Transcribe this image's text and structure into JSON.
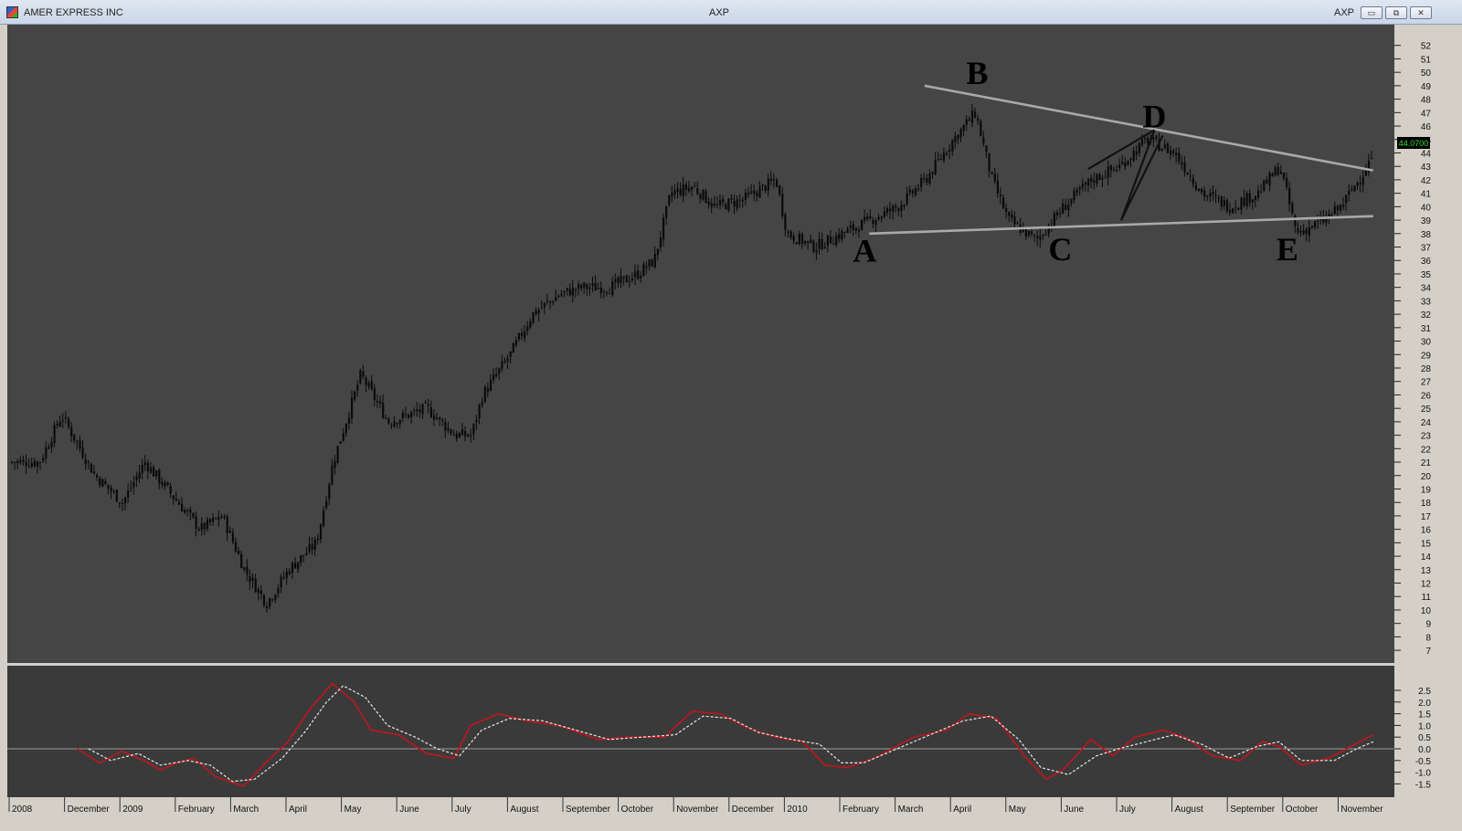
{
  "window": {
    "title_left": "AMER EXPRESS INC",
    "title_center": "AXP",
    "title_right": "AXP",
    "buttons": {
      "minimize": "▭",
      "restore": "⧉",
      "close": "✕"
    }
  },
  "colors": {
    "price_bg": "#454545",
    "ind_bg": "#3a3a3a",
    "candle": "#0a0a0a",
    "trendline": "#a9a9a9",
    "macd": "#c0161d",
    "signal": "#e8e8e8",
    "last_price_bg": "#000000",
    "last_price_fg": "#2fe02f"
  },
  "chart_data": [
    {
      "type": "candlestick",
      "symbol": "AXP",
      "ylim": [
        6,
        53
      ],
      "y_ticks": [
        7,
        8,
        9,
        10,
        11,
        12,
        13,
        14,
        15,
        16,
        17,
        18,
        19,
        20,
        21,
        22,
        23,
        24,
        25,
        26,
        27,
        28,
        29,
        30,
        31,
        32,
        33,
        34,
        35,
        36,
        37,
        38,
        39,
        40,
        41,
        42,
        43,
        44,
        45,
        46,
        47,
        48,
        49,
        50,
        51,
        52
      ],
      "last_price": "44.0700",
      "x_ticks": [
        "2008",
        "December",
        "2009",
        "February",
        "March",
        "April",
        "May",
        "June",
        "July",
        "August",
        "September",
        "October",
        "November",
        "December",
        "2010",
        "February",
        "March",
        "April",
        "May",
        "June",
        "July",
        "August",
        "September",
        "October",
        "November"
      ],
      "close_path": [
        [
          0,
          21
        ],
        [
          0.5,
          21
        ],
        [
          0.9,
          24.5
        ],
        [
          1.5,
          20
        ],
        [
          2,
          18
        ],
        [
          2.4,
          21
        ],
        [
          3,
          18
        ],
        [
          3.4,
          16
        ],
        [
          3.8,
          17
        ],
        [
          4.2,
          13
        ],
        [
          4.6,
          10.5
        ],
        [
          5,
          13
        ],
        [
          5.5,
          15
        ],
        [
          5.8,
          21
        ],
        [
          6.3,
          27.5
        ],
        [
          6.8,
          24
        ],
        [
          7.5,
          25
        ],
        [
          8,
          23
        ],
        [
          8.3,
          23
        ],
        [
          8.5,
          26
        ],
        [
          9,
          29
        ],
        [
          9.4,
          32
        ],
        [
          9.9,
          33.5
        ],
        [
          10.3,
          34
        ],
        [
          10.8,
          34
        ],
        [
          11.3,
          35
        ],
        [
          11.6,
          36
        ],
        [
          11.9,
          41
        ],
        [
          12.3,
          41.5
        ],
        [
          12.7,
          40
        ],
        [
          13.2,
          40.5
        ],
        [
          13.6,
          41.5
        ],
        [
          13.8,
          42
        ],
        [
          14,
          38
        ],
        [
          14.5,
          37
        ],
        [
          15,
          38
        ],
        [
          15.5,
          39
        ],
        [
          16,
          40
        ],
        [
          16.5,
          42
        ],
        [
          17,
          45
        ],
        [
          17.4,
          47
        ],
        [
          17.7,
          42
        ],
        [
          18,
          39
        ],
        [
          18.5,
          37.5
        ],
        [
          19,
          40
        ],
        [
          19.5,
          42
        ],
        [
          20,
          43
        ],
        [
          20.5,
          45
        ],
        [
          21,
          44
        ],
        [
          21.5,
          41
        ],
        [
          22,
          40
        ],
        [
          22.5,
          41
        ],
        [
          22.9,
          43
        ],
        [
          23.2,
          38
        ],
        [
          23.7,
          39
        ],
        [
          24,
          40
        ],
        [
          24.4,
          42.5
        ],
        [
          24.6,
          44
        ]
      ],
      "annotations": [
        {
          "label": "A",
          "x": 15.42,
          "price": 36.8
        },
        {
          "label": "B",
          "x": 17.45,
          "price": 50.0
        },
        {
          "label": "C",
          "x": 18.95,
          "price": 36.9
        },
        {
          "label": "D",
          "x": 20.65,
          "price": 46.8
        },
        {
          "label": "E",
          "x": 23.05,
          "price": 36.9
        }
      ],
      "trendlines": [
        {
          "name": "upper",
          "from": [
            16.5,
            49.0
          ],
          "to": [
            24.6,
            42.7
          ]
        },
        {
          "name": "lower",
          "from": [
            15.5,
            38.0
          ],
          "to": [
            24.6,
            39.3
          ]
        },
        {
          "name": "inner-1",
          "from": [
            19.45,
            42.8
          ],
          "to": [
            20.65,
            45.7
          ]
        },
        {
          "name": "inner-2",
          "from": [
            20.65,
            45.7
          ],
          "to": [
            20.05,
            39.0
          ]
        },
        {
          "name": "inner-3",
          "from": [
            20.05,
            39.0
          ],
          "to": [
            20.8,
            45.3
          ]
        }
      ]
    },
    {
      "type": "line",
      "name": "oscillator",
      "ylim": [
        -1.9,
        3.0
      ],
      "y_ticks": [
        "2.5",
        "2.0",
        "1.5",
        "1.0",
        "0.5",
        "0.0",
        "-0.5",
        "-1.0",
        "-1.5"
      ],
      "zero_line": 0,
      "series": [
        {
          "style": "solid",
          "points": [
            [
              1.2,
              0.0
            ],
            [
              1.6,
              -0.6
            ],
            [
              2.0,
              -0.1
            ],
            [
              2.4,
              -0.5
            ],
            [
              2.7,
              -0.9
            ],
            [
              3.0,
              -0.6
            ],
            [
              3.3,
              -0.4
            ],
            [
              3.7,
              -1.2
            ],
            [
              4.2,
              -1.6
            ],
            [
              4.6,
              -0.6
            ],
            [
              5.0,
              0.3
            ],
            [
              5.4,
              1.7
            ],
            [
              5.8,
              2.8
            ],
            [
              6.2,
              2.0
            ],
            [
              6.5,
              0.8
            ],
            [
              7.0,
              0.6
            ],
            [
              7.5,
              -0.2
            ],
            [
              8.0,
              -0.4
            ],
            [
              8.3,
              1.0
            ],
            [
              8.8,
              1.5
            ],
            [
              9.3,
              1.2
            ],
            [
              9.9,
              1.0
            ],
            [
              10.6,
              0.4
            ],
            [
              11.2,
              0.5
            ],
            [
              11.8,
              0.5
            ],
            [
              12.3,
              1.6
            ],
            [
              12.8,
              1.5
            ],
            [
              13.3,
              0.9
            ],
            [
              13.8,
              0.5
            ],
            [
              14.3,
              0.3
            ],
            [
              14.7,
              -0.7
            ],
            [
              15.1,
              -0.8
            ],
            [
              15.6,
              -0.4
            ],
            [
              16.3,
              0.5
            ],
            [
              16.9,
              0.8
            ],
            [
              17.3,
              1.5
            ],
            [
              17.8,
              1.3
            ],
            [
              18.3,
              -0.3
            ],
            [
              18.7,
              -1.3
            ],
            [
              19.0,
              -0.9
            ],
            [
              19.5,
              0.4
            ],
            [
              19.9,
              -0.3
            ],
            [
              20.3,
              0.5
            ],
            [
              20.8,
              0.8
            ],
            [
              21.2,
              0.5
            ],
            [
              21.7,
              -0.3
            ],
            [
              22.2,
              -0.5
            ],
            [
              22.6,
              0.3
            ],
            [
              22.9,
              0.1
            ],
            [
              23.3,
              -0.7
            ],
            [
              23.8,
              -0.4
            ],
            [
              24.2,
              0.1
            ],
            [
              24.6,
              0.6
            ]
          ]
        },
        {
          "style": "dashed",
          "points": [
            [
              1.4,
              0.0
            ],
            [
              1.8,
              -0.5
            ],
            [
              2.3,
              -0.2
            ],
            [
              2.7,
              -0.7
            ],
            [
              3.2,
              -0.5
            ],
            [
              3.6,
              -0.7
            ],
            [
              4.0,
              -1.4
            ],
            [
              4.4,
              -1.3
            ],
            [
              4.9,
              -0.4
            ],
            [
              5.3,
              0.7
            ],
            [
              5.7,
              2.0
            ],
            [
              6.0,
              2.7
            ],
            [
              6.4,
              2.2
            ],
            [
              6.8,
              1.0
            ],
            [
              7.3,
              0.5
            ],
            [
              7.7,
              0.0
            ],
            [
              8.1,
              -0.3
            ],
            [
              8.5,
              0.8
            ],
            [
              9.0,
              1.3
            ],
            [
              9.6,
              1.2
            ],
            [
              10.2,
              0.8
            ],
            [
              10.8,
              0.4
            ],
            [
              11.4,
              0.5
            ],
            [
              12.0,
              0.6
            ],
            [
              12.5,
              1.4
            ],
            [
              13.0,
              1.3
            ],
            [
              13.5,
              0.7
            ],
            [
              14.1,
              0.4
            ],
            [
              14.6,
              0.2
            ],
            [
              15.0,
              -0.6
            ],
            [
              15.4,
              -0.6
            ],
            [
              16.0,
              0.0
            ],
            [
              16.6,
              0.6
            ],
            [
              17.2,
              1.2
            ],
            [
              17.7,
              1.4
            ],
            [
              18.2,
              0.4
            ],
            [
              18.6,
              -0.8
            ],
            [
              19.1,
              -1.1
            ],
            [
              19.6,
              -0.3
            ],
            [
              20.0,
              0.0
            ],
            [
              20.5,
              0.3
            ],
            [
              21.0,
              0.6
            ],
            [
              21.5,
              0.2
            ],
            [
              22.0,
              -0.4
            ],
            [
              22.5,
              0.1
            ],
            [
              22.9,
              0.3
            ],
            [
              23.3,
              -0.5
            ],
            [
              23.9,
              -0.5
            ],
            [
              24.3,
              0.0
            ],
            [
              24.6,
              0.3
            ]
          ]
        }
      ]
    }
  ]
}
